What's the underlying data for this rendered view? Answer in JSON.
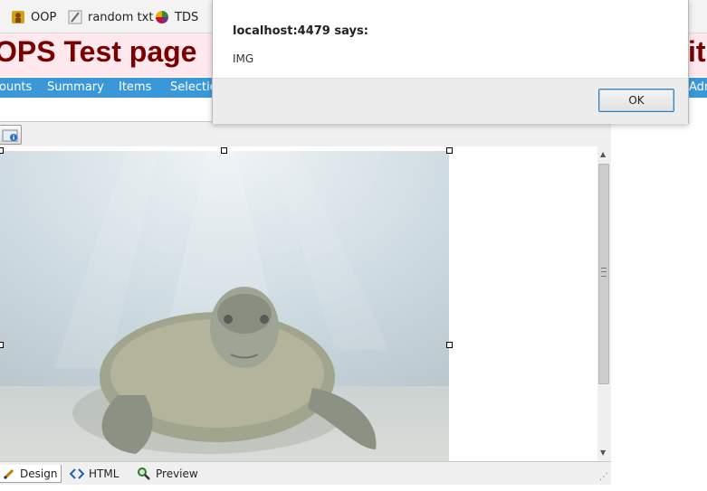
{
  "bookmarks": {
    "items": [
      {
        "label": "OOP",
        "icon": "oop-favicon"
      },
      {
        "label": "random txt",
        "icon": "pencil-icon"
      },
      {
        "label": "TDS",
        "icon": "tds-favicon"
      }
    ]
  },
  "page": {
    "title": "OPS Test page",
    "title_right_fragment": "it"
  },
  "nav": {
    "items": [
      "ounts",
      "Summary",
      "Items",
      "Selectio",
      "Adr"
    ]
  },
  "editor": {
    "image_description": "sea turtle underwater photo",
    "modes": [
      {
        "label": "Design",
        "icon": "pencil-icon",
        "active": true
      },
      {
        "label": "HTML",
        "icon": "code-brackets-icon",
        "active": false
      },
      {
        "label": "Preview",
        "icon": "magnifier-icon",
        "active": false
      }
    ]
  },
  "dialog": {
    "title": "localhost:4479 says:",
    "message": "IMG",
    "ok_label": "OK"
  },
  "colors": {
    "title": "#7a0000",
    "title_bar_bg": "#ffe8ee",
    "nav_bg": "#3a98d8",
    "ok_border": "#3c7fb1"
  }
}
